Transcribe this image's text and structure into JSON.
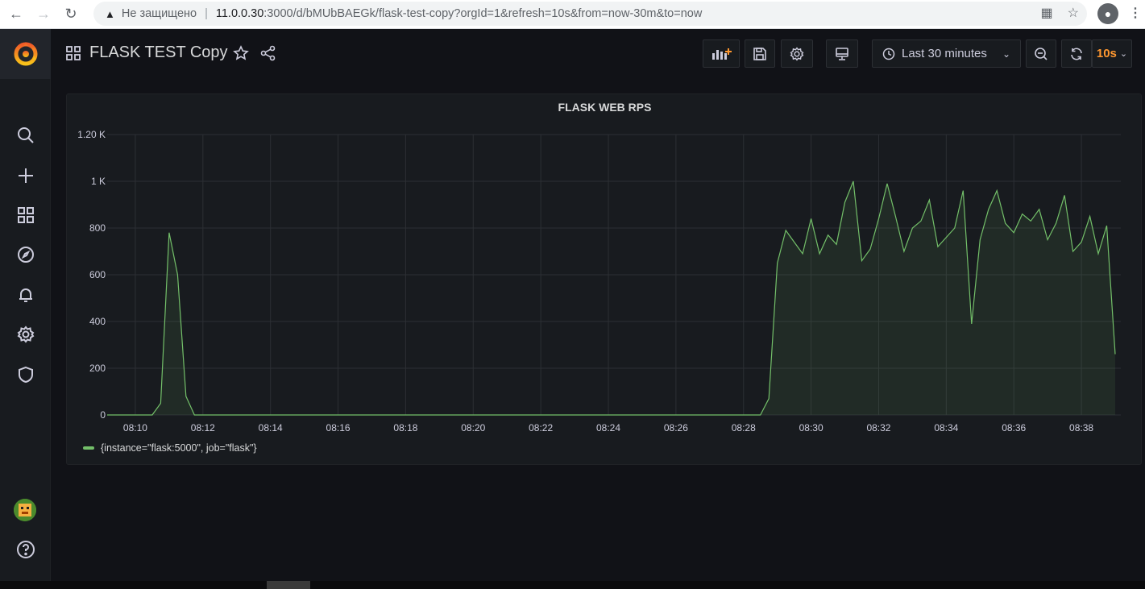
{
  "browser": {
    "insecure_label": "Не защищено",
    "url_host": "11.0.0.30",
    "url_rest": ":3000/d/bMUbBAEGk/flask-test-copy?orgId=1&refresh=10s&from=now-30m&to=now"
  },
  "dashboard": {
    "title": "FLASK TEST Copy",
    "time_range": "Last 30 minutes",
    "refresh_interval": "10s"
  },
  "sidemenu": {
    "items": [
      "search-icon",
      "plus-icon",
      "dashboards-icon",
      "explore-icon",
      "alerting-icon",
      "configuration-icon",
      "shield-icon"
    ]
  },
  "panel": {
    "title": "FLASK WEB RPS",
    "legend_label": "{instance=\"flask:5000\", job=\"flask\"}"
  },
  "colors": {
    "series": "#73bf69",
    "accent_refresh": "#ff9830",
    "background": "#111217"
  },
  "chart_data": {
    "type": "area",
    "title": "FLASK WEB RPS",
    "xlabel": "",
    "ylabel": "",
    "x_ticks": [
      "08:10",
      "08:12",
      "08:14",
      "08:16",
      "08:18",
      "08:20",
      "08:22",
      "08:24",
      "08:26",
      "08:28",
      "08:30",
      "08:32",
      "08:34",
      "08:36",
      "08:38"
    ],
    "y_ticks": [
      "0",
      "200",
      "400",
      "600",
      "800",
      "1 K",
      "1.20 K"
    ],
    "ylim": [
      0,
      1200
    ],
    "xlim": [
      "08:09:10",
      "08:39:10"
    ],
    "grid": true,
    "legend_position": "bottom-left",
    "series": [
      {
        "name": "{instance=\"flask:5000\", job=\"flask\"}",
        "color": "#73bf69",
        "x": [
          "08:09:10",
          "08:10:00",
          "08:10:30",
          "08:10:45",
          "08:11:00",
          "08:11:15",
          "08:11:30",
          "08:11:45",
          "08:12:00",
          "08:28:00",
          "08:28:30",
          "08:28:45",
          "08:29:00",
          "08:29:15",
          "08:29:30",
          "08:29:45",
          "08:30:00",
          "08:30:15",
          "08:30:30",
          "08:30:45",
          "08:31:00",
          "08:31:15",
          "08:31:30",
          "08:31:45",
          "08:32:00",
          "08:32:15",
          "08:32:30",
          "08:32:45",
          "08:33:00",
          "08:33:15",
          "08:33:30",
          "08:33:45",
          "08:34:00",
          "08:34:15",
          "08:34:30",
          "08:34:45",
          "08:35:00",
          "08:35:15",
          "08:35:30",
          "08:35:45",
          "08:36:00",
          "08:36:15",
          "08:36:30",
          "08:36:45",
          "08:37:00",
          "08:37:15",
          "08:37:30",
          "08:37:45",
          "08:38:00",
          "08:38:15",
          "08:38:30",
          "08:38:45",
          "08:39:00"
        ],
        "y": [
          0,
          0,
          0,
          50,
          780,
          600,
          80,
          0,
          0,
          0,
          0,
          70,
          650,
          790,
          740,
          690,
          840,
          690,
          770,
          730,
          910,
          1000,
          660,
          710,
          840,
          990,
          850,
          700,
          800,
          830,
          920,
          720,
          760,
          800,
          960,
          390,
          750,
          880,
          960,
          820,
          780,
          860,
          830,
          880,
          750,
          820,
          940,
          700,
          740,
          850,
          690,
          810,
          260
        ]
      }
    ]
  }
}
